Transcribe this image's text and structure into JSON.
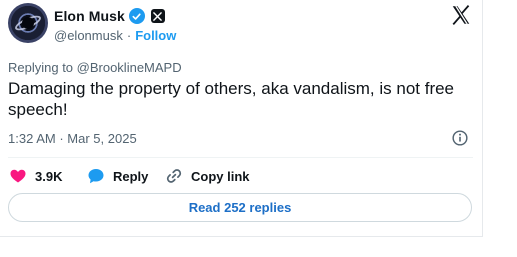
{
  "author": {
    "name": "Elon Musk",
    "handle": "@elonmusk",
    "separator": "·",
    "follow_label": "Follow"
  },
  "tweet": {
    "replying_to": "Replying to @BrooklineMAPD",
    "text": "Damaging the property of others, aka vandalism, is not free speech!",
    "time": "1:32 AM",
    "meta_separator": "·",
    "date": "Mar 5, 2025"
  },
  "actions": {
    "like_count": "3.9K",
    "reply_label": "Reply",
    "copy_link_label": "Copy link"
  },
  "read_replies_label": "Read 252 replies",
  "colors": {
    "accent": "#1d9bf0",
    "like": "#f91880",
    "text": "#0f1419",
    "muted": "#536471"
  },
  "icons": [
    "avatar",
    "verified-badge-icon",
    "x-affiliate-badge-icon",
    "x-logo-icon",
    "info-icon",
    "heart-icon",
    "reply-bubble-icon",
    "link-icon"
  ]
}
